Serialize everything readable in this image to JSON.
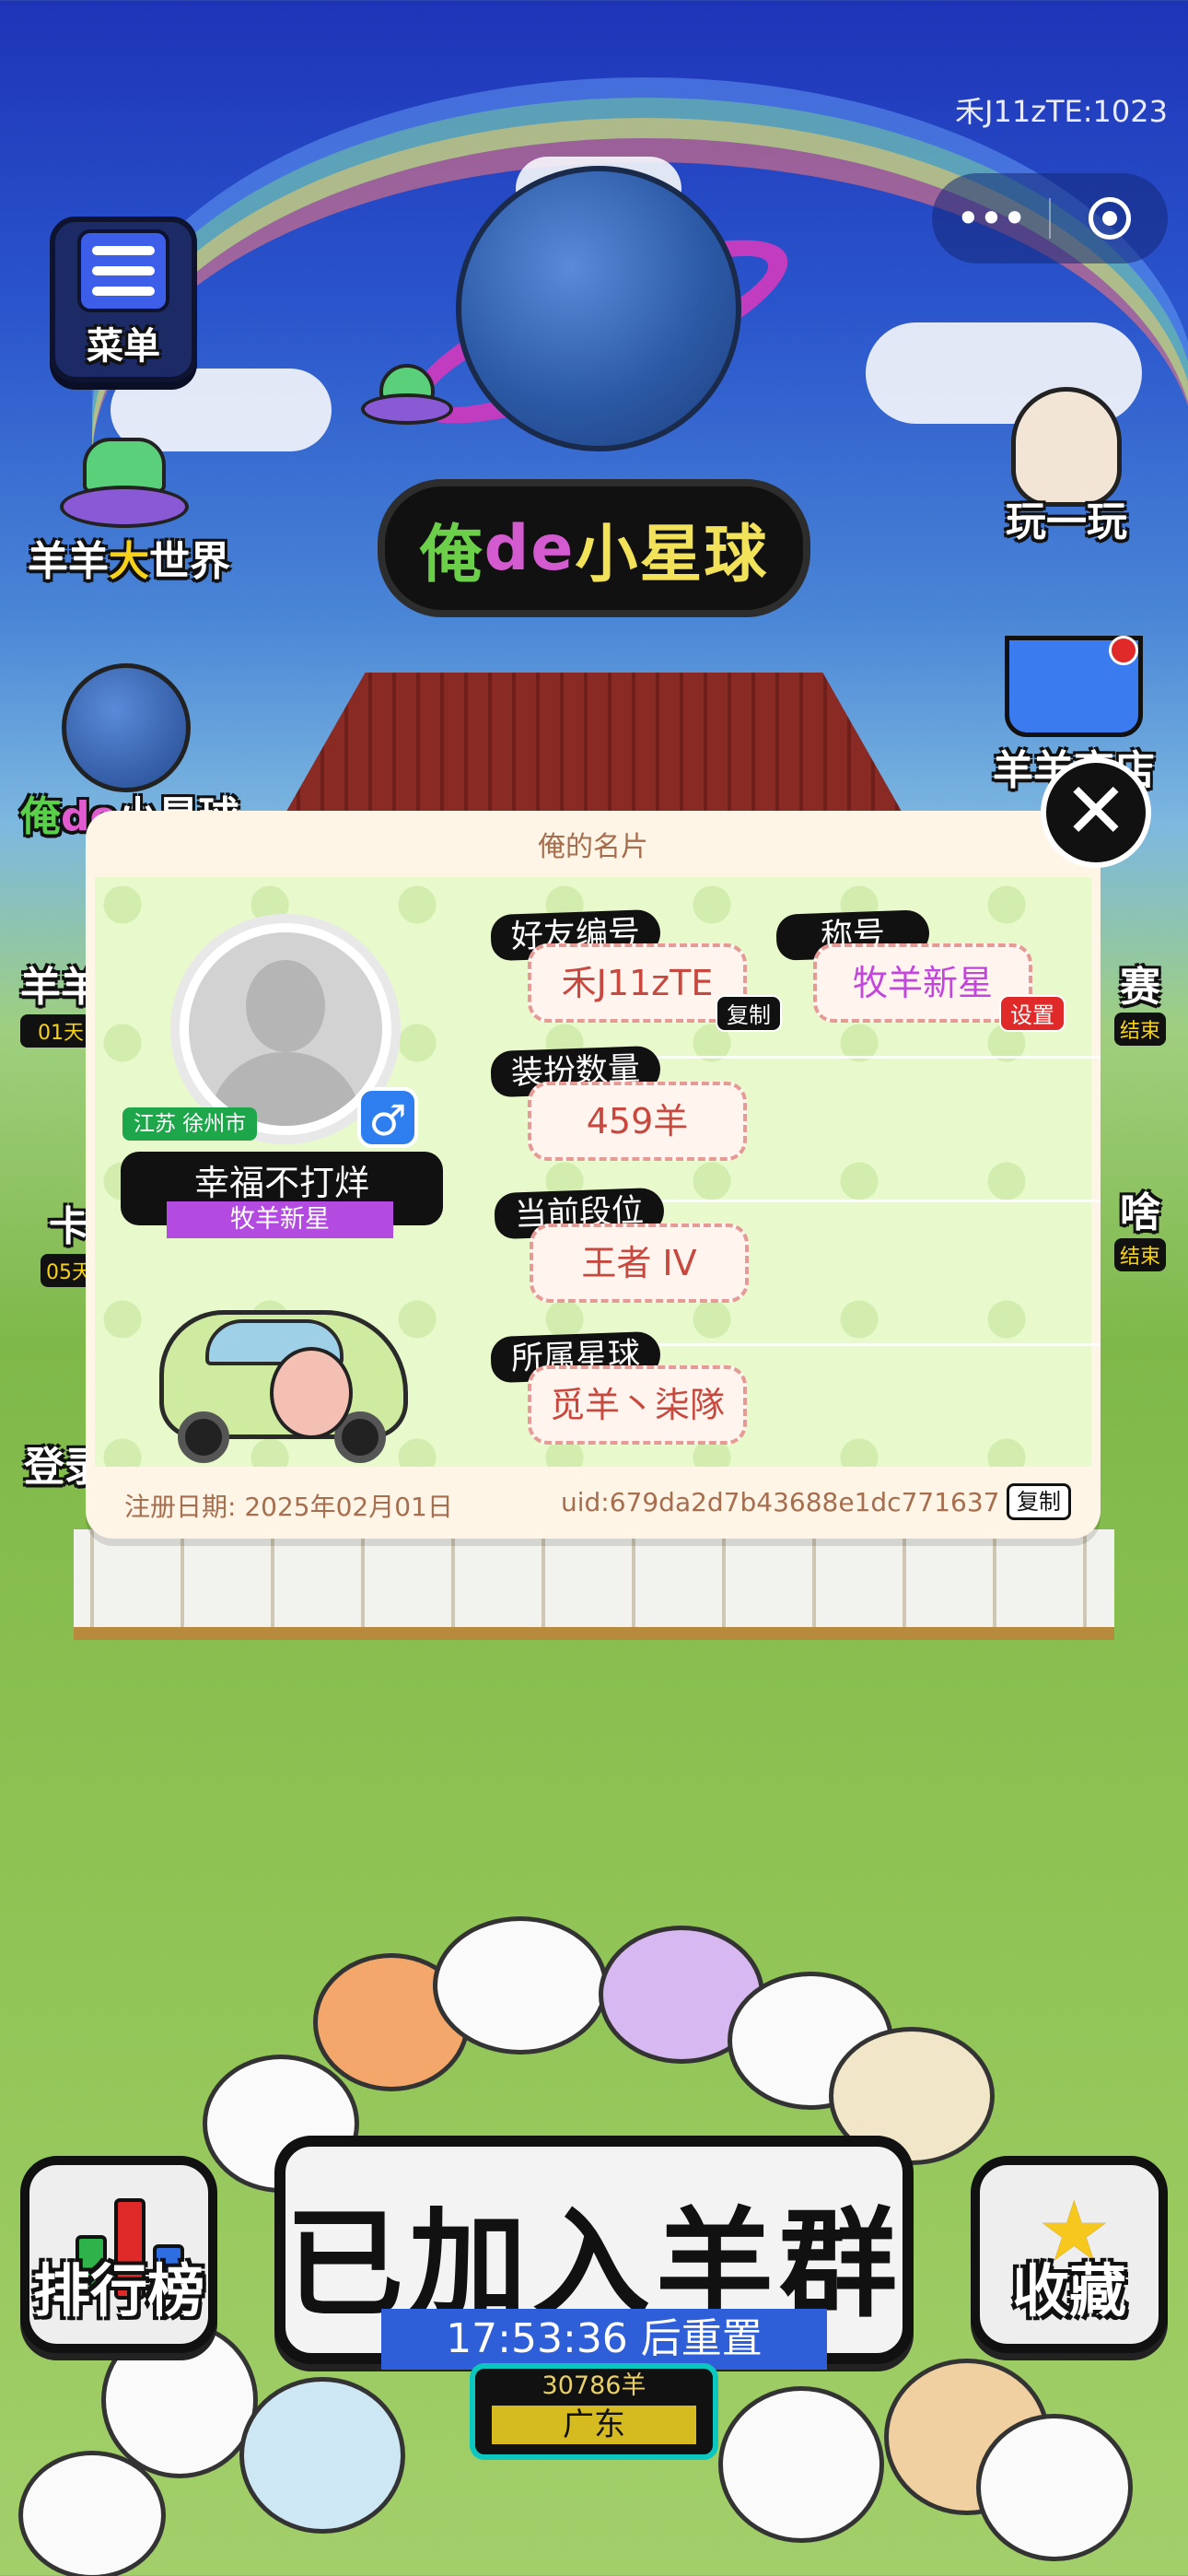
{
  "top": {
    "player_id_label": "禾J11zTE:1023",
    "capsule_more": "•••"
  },
  "left_buttons": {
    "menu": "菜单",
    "world": {
      "a": "羊羊",
      "b": "大",
      "c": "世界"
    },
    "planet": {
      "a": "俺",
      "b": "de",
      "c": "小星球"
    },
    "partial_1": "羊羊",
    "partial_1_badge": "01天",
    "partial_2": "卡",
    "partial_2_badge": "05天",
    "partial_3": "登录"
  },
  "right_buttons": {
    "play": "玩一玩",
    "shop": "羊羊商店",
    "contest": "赛",
    "contest_badge": "结束",
    "what": "啥",
    "what_badge": "结束"
  },
  "center_title": {
    "a": "俺",
    "b": "de",
    "c": "小星球"
  },
  "card": {
    "title": "俺的名片",
    "location": "江苏 徐州市",
    "gender_symbol": "♂",
    "nickname": "幸福不打烊",
    "rank_title": "牧羊新星",
    "friend_id_label": "好友编号",
    "friend_id_value": "禾J11zTE",
    "copy_label": "复制",
    "nickname_title_label": "称号",
    "nickname_title_value": "牧羊新星",
    "set_label": "设置",
    "outfit_label": "装扮数量",
    "outfit_value": "459羊",
    "tier_label": "当前段位",
    "tier_value": "王者 IV",
    "planet_label": "所属星球",
    "planet_value": "觅羊丶柒隊",
    "reg_date": "注册日期: 2025年02月01日",
    "uid": "uid:679da2d7b43688e1dc771637",
    "footer_copy_label": "复制",
    "close_symbol": "✕"
  },
  "bottom": {
    "join_text": "已加入羊群",
    "reset_text": "17:53:36 后重置",
    "score": "30786羊",
    "region": "广东",
    "leaderboard": "排行榜",
    "favorite": "收藏"
  },
  "colors": {
    "accent_green": "#1ea74a",
    "tag_purple": "#b44be0",
    "value_red": "#c7483e",
    "gender_blue": "#2f7ef0",
    "reset_blue": "#2f5fd8"
  }
}
